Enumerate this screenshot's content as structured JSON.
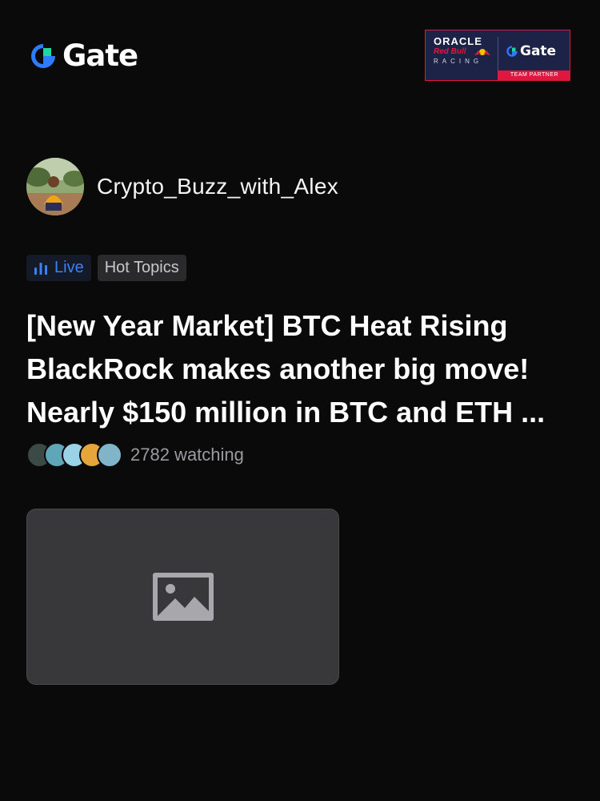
{
  "brand": {
    "name": "Gate",
    "accent": "#2f7bff",
    "accent2": "#1fd6a0"
  },
  "partner_badge": {
    "line1": "ORACLE",
    "line2": "Red Bull",
    "line3": "RACING",
    "brand": "Gate",
    "strip": "TEAM PARTNER"
  },
  "author": {
    "name": "Crypto_Buzz_with_Alex"
  },
  "tags": {
    "live": "Live",
    "topic": "Hot Topics"
  },
  "post": {
    "title_lines": [
      "[New Year Market] BTC Heat Rising",
      "BlackRock makes another big move!",
      "Nearly $150 million in BTC and ETH ..."
    ]
  },
  "viewers": {
    "count_text": "2782 watching"
  },
  "colors": {
    "background": "#0a0a0b",
    "live": "#3b82f6",
    "placeholder": "#38383b"
  },
  "icons": {
    "live": "bar-chart-icon",
    "thumbnail": "image-placeholder-icon"
  }
}
